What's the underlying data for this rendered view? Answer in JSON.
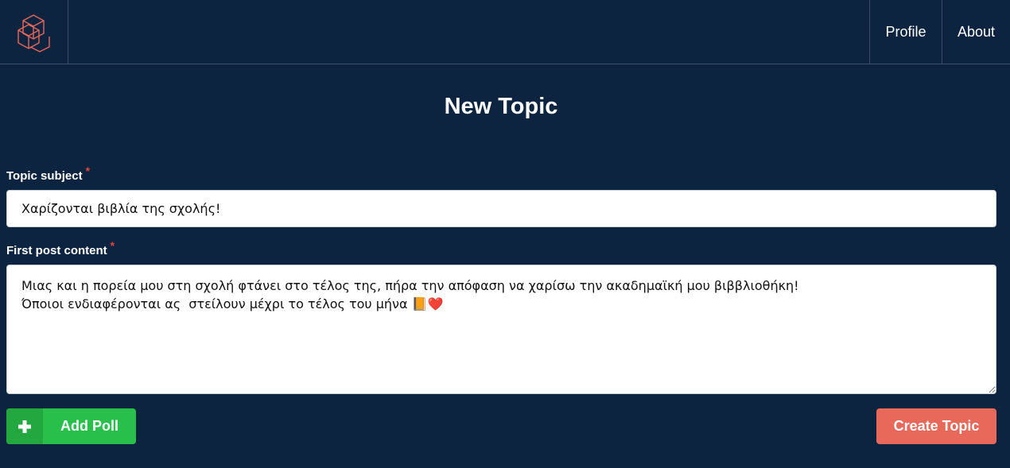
{
  "header": {
    "logo_icon": "cube-logo-icon",
    "nav": [
      {
        "label": "Profile"
      },
      {
        "label": "About"
      }
    ]
  },
  "page": {
    "title": "New Topic"
  },
  "form": {
    "subject": {
      "label": "Topic subject",
      "required_mark": "*",
      "value": "Χαρίζονται βιβλία της σχολής!"
    },
    "content": {
      "label": "First post content",
      "required_mark": "*",
      "value": "Μιας και η πορεία μου στη σχολή φτάνει στο τέλος της, πήρα την απόφαση να χαρίσω την ακαδημαϊκή μου βιββλιοθήκη!\nΌποιοι ενδιαφέρονται ας  στείλουν μέχρι το τέλος του μήνα 📙❤️"
    },
    "add_poll_label": "Add Poll",
    "add_poll_icon": "plus-icon",
    "create_label": "Create Topic"
  },
  "colors": {
    "background": "#0d2440",
    "logo": "#e8685a",
    "required": "#e0463a",
    "add_poll": "#28c04a",
    "create": "#e8685a"
  }
}
